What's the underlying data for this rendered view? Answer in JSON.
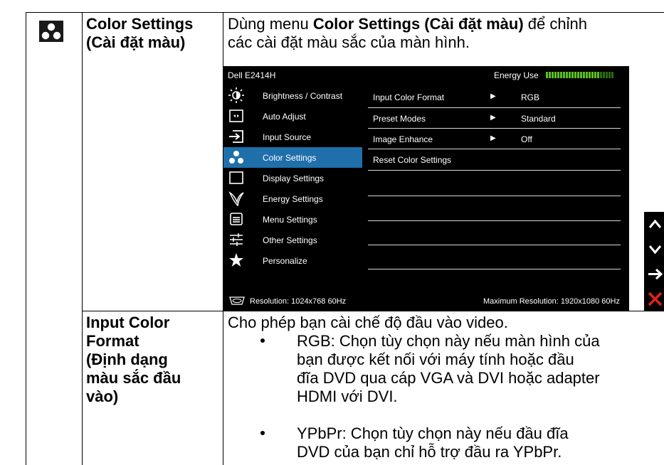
{
  "row1": {
    "title_line1": "Color Settings",
    "title_line2": "(Cài đặt màu)",
    "desc_line1_pre": "Dùng menu ",
    "desc_line1_bold": "Color Settings (Cài đặt màu)",
    "desc_line1_post": " để chỉnh",
    "desc_line2": "các cài đặt màu sắc của màn hình."
  },
  "osd": {
    "model": "Dell E2414H",
    "energy_label": "Energy Use",
    "energy_level": 0.8,
    "menu": [
      {
        "icon": "brightness-icon",
        "label": "Brightness / Contrast"
      },
      {
        "icon": "auto-adjust-icon",
        "label": "Auto Adjust"
      },
      {
        "icon": "input-source-icon",
        "label": "Input Source"
      },
      {
        "icon": "color-settings-icon",
        "label": "Color Settings"
      },
      {
        "icon": "display-settings-icon",
        "label": "Display Settings"
      },
      {
        "icon": "energy-settings-icon",
        "label": "Energy Settings"
      },
      {
        "icon": "menu-settings-icon",
        "label": "Menu Settings"
      },
      {
        "icon": "other-settings-icon",
        "label": "Other Settings"
      },
      {
        "icon": "star-icon",
        "label": "Personalize"
      }
    ],
    "active_index": 3,
    "submenu": [
      {
        "label": "Input Color Format",
        "value": "RGB",
        "arrow": "▶"
      },
      {
        "label": "Preset Modes",
        "value": "Standard",
        "arrow": "▶"
      },
      {
        "label": "Image Enhance",
        "value": "Off",
        "arrow": "▶"
      },
      {
        "label": "Reset Color Settings",
        "value": "",
        "arrow": ""
      }
    ],
    "resolution": "Resolution: 1024x768 60Hz",
    "max_resolution": "Maximum Resolution: 1920x1080 60Hz"
  },
  "side_buttons": [
    "up-arrow-icon",
    "down-arrow-icon",
    "enter-arrow-icon",
    "close-icon"
  ],
  "row2": {
    "title_lines": [
      "Input Color",
      "Format",
      "(Định dạng",
      "màu sắc đầu",
      "vào)"
    ],
    "intro": "Cho phép bạn cài chế độ đầu vào video.",
    "bullets": [
      [
        "RGB: Chọn tùy chọn này nếu màn hình của",
        "bạn được kết nối với máy tính hoặc đầu",
        "đĩa DVD qua cáp VGA và DVI hoặc adapter",
        "HDMI với DVI."
      ],
      [
        "YPbPr: Chọn tùy chọn này nếu đầu đĩa",
        "DVD của bạn chỉ hỗ trợ đầu ra YPbPr."
      ]
    ]
  }
}
